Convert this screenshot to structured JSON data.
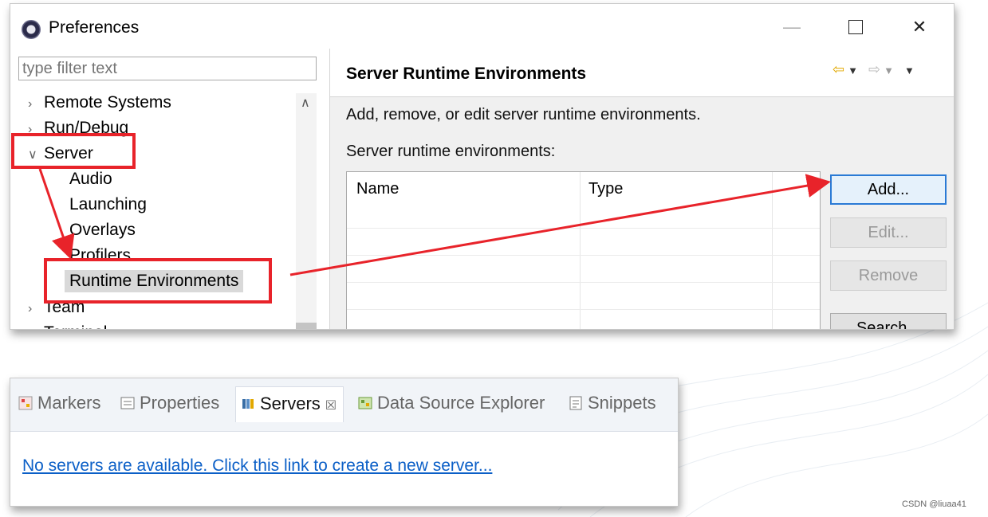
{
  "window": {
    "title": "Preferences",
    "minimize": "—",
    "close": "✕"
  },
  "filter": {
    "placeholder": "type filter text"
  },
  "tree": {
    "items": [
      {
        "label": "Remote Systems",
        "expanded": false
      },
      {
        "label": "Run/Debug",
        "expanded": false
      },
      {
        "label": "Server",
        "expanded": true
      },
      {
        "label": "Audio"
      },
      {
        "label": "Launching"
      },
      {
        "label": "Overlays"
      },
      {
        "label": "Profilers"
      },
      {
        "label": "Runtime Environments",
        "selected": true
      },
      {
        "label": "Team",
        "expanded": false
      },
      {
        "label": "Terminal",
        "expanded": false
      }
    ]
  },
  "page": {
    "title": "Server Runtime Environments",
    "description": "Add, remove, or edit server runtime environments.",
    "list_label": "Server runtime environments:",
    "columns": [
      "Name",
      "Type"
    ],
    "buttons": {
      "add": "Add...",
      "edit": "Edit...",
      "remove": "Remove",
      "search": "Search..."
    }
  },
  "servers_view": {
    "tabs": [
      {
        "label": "Markers",
        "icon": "markers-icon"
      },
      {
        "label": "Properties",
        "icon": "properties-icon"
      },
      {
        "label": "Servers",
        "icon": "servers-icon",
        "active": true,
        "close": "☒"
      },
      {
        "label": "Data Source Explorer",
        "icon": "data-source-icon"
      },
      {
        "label": "Snippets",
        "icon": "snippets-icon"
      }
    ],
    "link": "No servers are available. Click this link to create a new server..."
  },
  "watermark": "CSDN @liuaa41",
  "colors": {
    "annotation_red": "#e8232a",
    "selection": "#d9d9d9",
    "link_blue": "#0b5fc7",
    "focus_blue": "#2a7ad5"
  }
}
